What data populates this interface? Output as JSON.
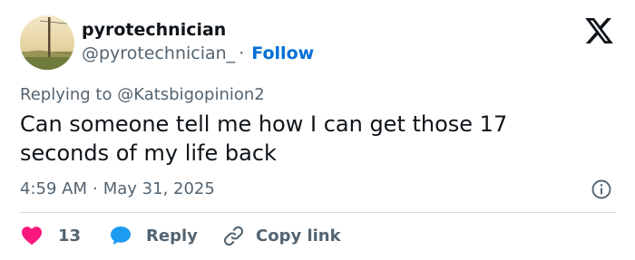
{
  "user": {
    "display_name": "pyrotechnician",
    "handle": "@pyrotechnician_",
    "separator": "·",
    "follow_label": "Follow"
  },
  "reply_line": "Replying to @Katsbigopinion2",
  "tweet_text": "Can someone tell me how I can get those 17 seconds of my life back",
  "meta": {
    "time": "4:59 AM",
    "separator": "·",
    "date": "May 31, 2025"
  },
  "actions": {
    "like_count": "13",
    "reply_label": "Reply",
    "copy_link_label": "Copy link"
  },
  "icons": {
    "brand": "x-logo-icon",
    "info": "info-icon",
    "like": "heart-icon",
    "reply": "speech-bubble-icon",
    "copy": "link-icon"
  },
  "colors": {
    "text_primary": "#0f1419",
    "text_secondary": "#536471",
    "link": "#006fd6",
    "like": "#f91880",
    "reply": "#1d9bf0",
    "divider": "#cfd9de"
  }
}
